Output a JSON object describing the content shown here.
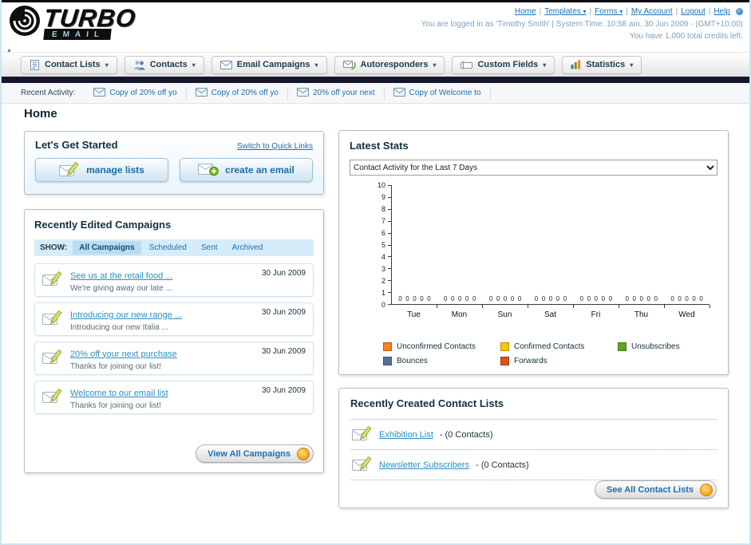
{
  "colors": {
    "link_blue": "#1d6fb0",
    "accent_orange": "#ef9005",
    "dark_bar": "#15152b",
    "filter_bar_bg": "#d7ecf9"
  },
  "header": {
    "logo_primary": "TURBO",
    "logo_secondary": "EMAIL",
    "top_links": [
      {
        "label": "Home",
        "dropdown": false
      },
      {
        "label": "Templates",
        "dropdown": true
      },
      {
        "label": "Forms",
        "dropdown": true
      },
      {
        "label": "My Account",
        "dropdown": false
      },
      {
        "label": "Logout",
        "dropdown": false
      },
      {
        "label": "Help",
        "dropdown": false
      }
    ],
    "session_line": "You are logged in as 'Timothy Smith' | System Time: 10:58 am, 30 Jun 2009 - (GMT+10:00)",
    "credits_line": "You have 1,000 total credits left."
  },
  "nav": {
    "tabs": [
      {
        "label": "Contact Lists",
        "icon": "contact-lists-icon"
      },
      {
        "label": "Contacts",
        "icon": "contacts-icon"
      },
      {
        "label": "Email Campaigns",
        "icon": "email-campaigns-icon"
      },
      {
        "label": "Autoresponders",
        "icon": "autoresponders-icon"
      },
      {
        "label": "Custom Fields",
        "icon": "custom-fields-icon"
      },
      {
        "label": "Statistics",
        "icon": "statistics-icon"
      }
    ]
  },
  "recent_activity": {
    "label": "Recent Activity:",
    "items": [
      "Copy of 20% off yo",
      "Copy of 20% off yo",
      "20% off your next",
      "Copy of Welcome to"
    ]
  },
  "page": {
    "title": "Home"
  },
  "get_started": {
    "title": "Let's Get Started",
    "switch_link": "Switch to Quick Links",
    "manage_lists_label": "manage lists",
    "create_email_label": "create an email"
  },
  "campaigns": {
    "title": "Recently Edited Campaigns",
    "show_label": "SHOW:",
    "filters": [
      "All Campaigns",
      "Scheduled",
      "Sent",
      "Archived"
    ],
    "active_filter": "All Campaigns",
    "items": [
      {
        "title": "See us at the retail food ...",
        "subtitle": "We're giving away our late ...",
        "date": "30 Jun 2009"
      },
      {
        "title": "Introducing our new range ...",
        "subtitle": "Introducing our new Italia ...",
        "date": "30 Jun 2009"
      },
      {
        "title": "20% off your next purchase",
        "subtitle": "Thanks for joining our list!",
        "date": "30 Jun 2009"
      },
      {
        "title": "Welcome to our email list",
        "subtitle": "Thanks for joining our list!",
        "date": "30 Jun 2009"
      }
    ],
    "view_all_label": "View All Campaigns"
  },
  "stats": {
    "title": "Latest Stats",
    "selected_option": "Contact Activity for the Last 7 Days"
  },
  "chart_data": {
    "type": "bar",
    "title": "Contact Activity for the Last 7 Days",
    "categories": [
      "Tue",
      "Mon",
      "Sun",
      "Sat",
      "Fri",
      "Thu",
      "Wed"
    ],
    "series": [
      {
        "name": "Unconfirmed Contacts",
        "color": "#f6821f",
        "values": [
          0,
          0,
          0,
          0,
          0,
          0,
          0
        ]
      },
      {
        "name": "Confirmed Contacts",
        "color": "#fdc500",
        "values": [
          0,
          0,
          0,
          0,
          0,
          0,
          0
        ]
      },
      {
        "name": "Unsubscribes",
        "color": "#63a41e",
        "values": [
          0,
          0,
          0,
          0,
          0,
          0,
          0
        ]
      },
      {
        "name": "Bounces",
        "color": "#54709f",
        "values": [
          0,
          0,
          0,
          0,
          0,
          0,
          0
        ]
      },
      {
        "name": "Forwards",
        "color": "#e64d1d",
        "values": [
          0,
          0,
          0,
          0,
          0,
          0,
          0
        ]
      }
    ],
    "ylim": [
      0,
      10
    ],
    "ytick_step": 1,
    "grid": false,
    "legend_position": "bottom",
    "bar_value_labels": true
  },
  "contact_lists": {
    "title": "Recently Created Contact Lists",
    "items": [
      {
        "name": "Exhibition List",
        "detail": "- (0 Contacts)"
      },
      {
        "name": "Newsletter Subscribers",
        "detail": "- (0 Contacts)"
      }
    ],
    "see_all_label": "See All Contact Lists"
  }
}
